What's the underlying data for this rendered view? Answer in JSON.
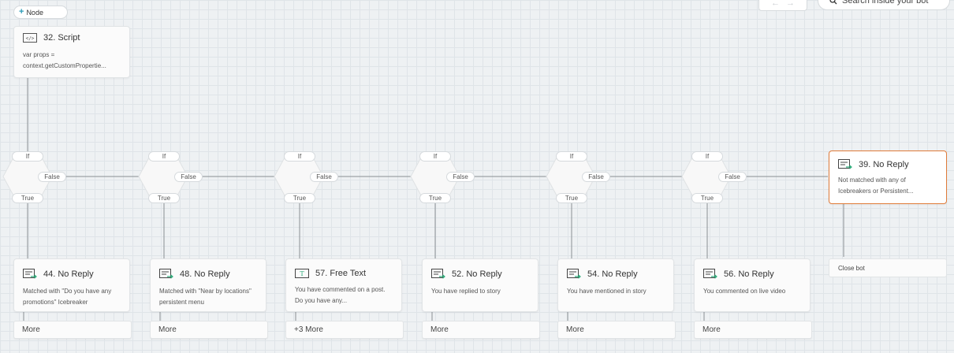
{
  "toolbar": {
    "add_node_label": "Node",
    "search_placeholder": "Search inside your bot"
  },
  "script_node": {
    "title": "32. Script",
    "line1": "var props =",
    "line2": "context.getCustomPropertie..."
  },
  "condition_labels": {
    "if": "If",
    "false": "False",
    "true": "True"
  },
  "nodes": [
    {
      "title": "44. No Reply",
      "body": "Matched with \"Do you have any promotions\" Icebreaker",
      "more": "More"
    },
    {
      "title": "48. No Reply",
      "body": "Matched with \"Near by locations\" persistent menu",
      "more": "More"
    },
    {
      "title": "57. Free Text",
      "body": "You have commented on a post. Do you have any...",
      "more": "+3 More"
    },
    {
      "title": "52. No Reply",
      "body": "You have replied to story",
      "more": "More"
    },
    {
      "title": "54. No Reply",
      "body": "You have mentioned in story",
      "more": "More"
    },
    {
      "title": "56. No Reply",
      "body": "You commented on live video",
      "more": "More"
    }
  ],
  "fallback_node": {
    "title": "39. No Reply",
    "body": "Not matched with any of Icebreakers or Persistent...",
    "close_label": "Close bot"
  },
  "colors": {
    "selected_border": "#e07b39",
    "accent": "#2a9bb7",
    "icon_green": "#2fae7c"
  },
  "icons": {
    "reply": "message-reply-icon",
    "text": "text-input-icon",
    "script": "code-icon",
    "search": "search-icon"
  }
}
